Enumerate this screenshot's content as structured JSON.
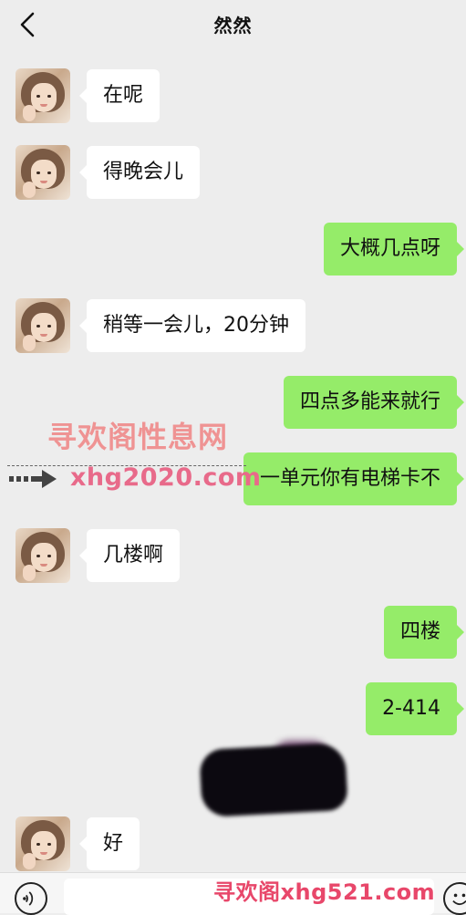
{
  "header": {
    "title": "然然"
  },
  "messages": [
    {
      "side": "left",
      "text": "在呢"
    },
    {
      "side": "left",
      "text": "得晚会儿"
    },
    {
      "side": "right",
      "text": "大概几点呀"
    },
    {
      "side": "left",
      "text": "稍等一会儿，20分钟"
    },
    {
      "side": "right",
      "text": "四点多能来就行"
    },
    {
      "side": "right",
      "text": "一单元你有电梯卡不"
    },
    {
      "side": "left",
      "text": "几楼啊"
    },
    {
      "side": "right",
      "text": "四楼"
    },
    {
      "side": "right",
      "text": "2-414"
    },
    {
      "side": "left",
      "text": "好"
    }
  ],
  "watermark": {
    "title": "寻欢阁性息网",
    "url": "xhg2020.com",
    "bottom": "寻欢阁xhg521.com"
  },
  "colors": {
    "chat_bg": "#ededed",
    "sent_bubble": "#95ec69",
    "received_bubble": "#ffffff"
  },
  "icons": {
    "back": "chevron-left-icon",
    "voice": "voice-icon",
    "emoji": "emoji-icon"
  }
}
